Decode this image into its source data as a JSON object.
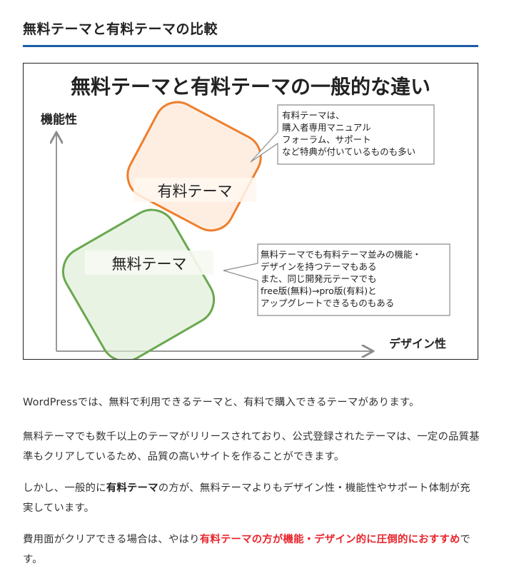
{
  "section": {
    "title": "無料テーマと有料テーマの比較"
  },
  "figure": {
    "title": "無料テーマと有料テーマの一般的な違い",
    "y_axis_label": "機能性",
    "x_axis_label": "デザイン性",
    "paid_label": "有料テーマ",
    "free_label": "無料テーマ",
    "paid_callout": [
      "有料テーマは、",
      "購入者専用マニュアル",
      "フォーラム、サポート",
      "など特典が付いているものも多い"
    ],
    "free_callout": [
      "無料テーマでも有料テーマ並みの機能・",
      "デザインを持つテーマもある",
      "また、同じ開発元テーマでも",
      "free版(無料)→pro版(有料)と",
      "アップグレートできるものもある"
    ],
    "colors": {
      "paid_border": "#ee7f2d",
      "paid_fill": "#fde8d8",
      "free_border": "#6aa84f",
      "free_fill": "#dcebd2",
      "axis": "#8c8c8c"
    }
  },
  "body": {
    "p1": "WordPressでは、無料で利用できるテーマと、有料で購入できるテーマがあります。",
    "p2": "無料テーマでも数千以上のテーマがリリースされており、公式登録されたテーマは、一定の品質基準もクリアしているため、品質の高いサイトを作ることができます。",
    "p3_a": "しかし、一般的に",
    "p3_bold": "有料テーマ",
    "p3_b": "の方が、無料テーマよりもデザイン性・機能性やサポート体制が充実しています。",
    "p4_a": "費用面がクリアできる場合は、やはり",
    "p4_red": "有料テーマの方が機能・デザイン的に圧倒的におすすめ",
    "p4_b": "です。"
  }
}
